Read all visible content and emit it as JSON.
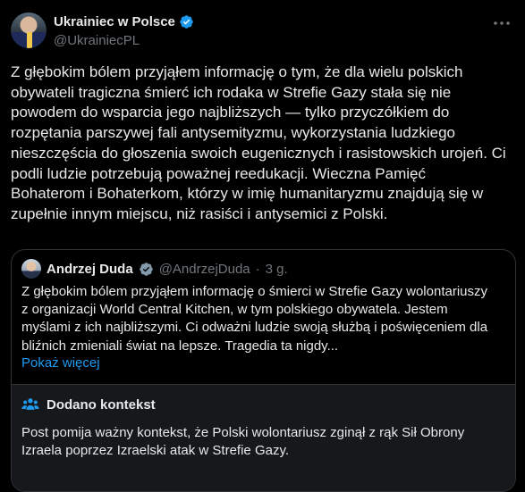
{
  "post": {
    "author_name": "Ukrainiec w Polsce",
    "author_handle": "@UkrainiecPL",
    "body": "Z głębokim bólem przyjąłem informację o tym, że dla wielu polskich\nobywateli tragiczna śmierć ich rodaka w Strefie Gazy stała się nie\npowodem do wsparcia jego najbliższych — tylko przyczółkiem do\nrozpętania parszywej fali antysemityzmu, wykorzystania ludzkiego\nnieszczęścia do głoszenia swoich eugenicznych i rasistowskich urojeń. Ci\npodli ludzie potrzebują poważnej reedukacji. Wieczna Pamięć\nBohaterom i Bohaterkom, którzy w imię humanitaryzmu znajdują się w\nzupełnie innym miejscu, niż rasiści i antysemici z Polski."
  },
  "quote": {
    "author_name": "Andrzej Duda",
    "author_handle": "@AndrzejDuda",
    "separator": "·",
    "time": "3 g.",
    "text": "Z głębokim bólem przyjąłem informację o śmierci w Strefie Gazy wolontariuszy\nz organizacji World Central Kitchen, w tym polskiego obywatela. Jestem\nmyślami z ich najbliższymi. Ci odważni ludzie swoją służbą i poświęceniem dla\nbliźnich zmieniali świat na lepsze. Tragedia ta nigdy...",
    "show_more": "Pokaż więcej"
  },
  "community_note": {
    "title": "Dodano kontekst",
    "text": "Post pomija ważny kontekst, że Polski wolontariusz zginął z rąk Sił Obrony\nIzraela poprzez Izraelski atak w Strefie Gazy."
  },
  "icons": {
    "verified": "verified-badge-icon",
    "verified_gray": "gray-verified-badge-icon",
    "more": "more-options-icon",
    "community": "people-icon"
  },
  "colors": {
    "background": "#000000",
    "text": "#e7e9ea",
    "muted": "#71767b",
    "link": "#1d9bf0",
    "verified": "#1d9bf0",
    "note_bg": "#16181c",
    "border": "#2f3336"
  }
}
